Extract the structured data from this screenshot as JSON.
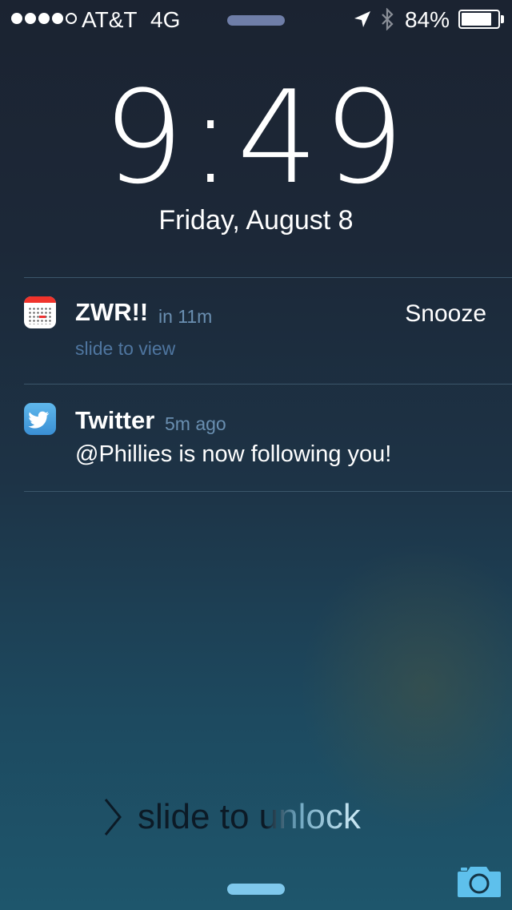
{
  "status_bar": {
    "signal_bars_filled": 4,
    "signal_bars_total": 5,
    "carrier": "AT&T",
    "network": "4G",
    "location_icon": "location-arrow-icon",
    "bluetooth_icon": "bluetooth-icon",
    "battery_percent_label": "84%",
    "battery_level": 0.84
  },
  "lock_screen": {
    "time": "9:49",
    "date": "Friday, August 8"
  },
  "notifications": [
    {
      "app_icon": "calendar-icon",
      "title": "ZWR!!",
      "time": "in 11m",
      "subtitle": "slide to view",
      "action": "Snooze"
    },
    {
      "app_icon": "twitter-icon",
      "title": "Twitter",
      "time": "5m ago",
      "body": "@Phillies is now following you!"
    }
  ],
  "unlock": {
    "label": "slide to unlock",
    "camera_icon": "camera-icon"
  },
  "colors": {
    "accent_muted": "#6a8fb1",
    "grabber_bottom": "#7fc8ec",
    "camera": "#5ec0ec"
  }
}
